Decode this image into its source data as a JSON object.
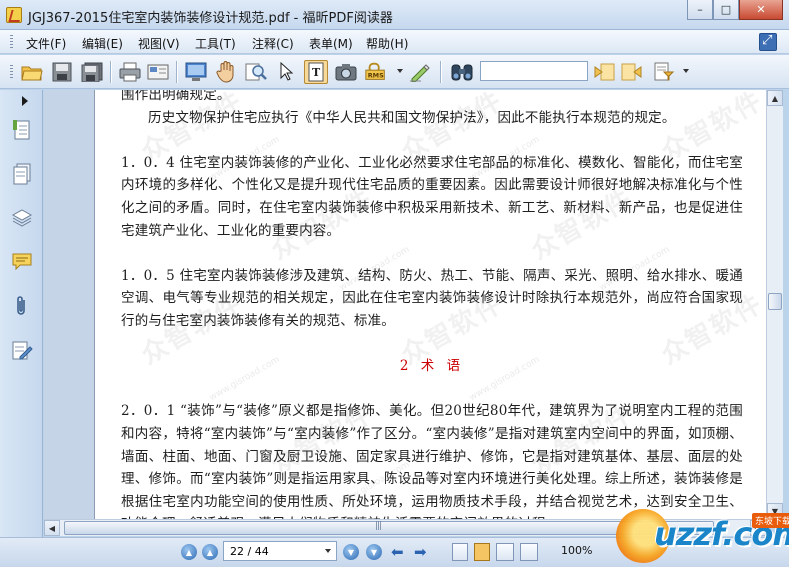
{
  "window": {
    "title": "JGJ367-2015住宅室内装饰装修设计规范.pdf - 福昕PDF阅读器",
    "minimize": "–",
    "maximize": "□",
    "close": "✕"
  },
  "menu": [
    "文件(F)",
    "编辑(E)",
    "视图(V)",
    "工具(T)",
    "注释(C)",
    "表单(M)",
    "帮助(H)"
  ],
  "toolbar": {
    "icons": [
      "open-folder-icon",
      "save-icon",
      "save-all-icon",
      "print-icon",
      "email-icon",
      "fullscreen-icon",
      "hand-tool-icon",
      "zoom-tool-icon",
      "select-arrow-icon",
      "text-select-icon",
      "snapshot-icon",
      "rms-icon",
      "sign-pen-icon",
      "binoculars-icon"
    ],
    "search_value": "",
    "nav_icons": [
      "find-prev-icon",
      "find-next-icon",
      "find-options-icon"
    ]
  },
  "left_panel": {
    "icons": [
      "bookmarks-icon",
      "pages-icon",
      "layers-icon",
      "comments-icon",
      "attachments-icon",
      "signature-icon"
    ]
  },
  "document": {
    "lines": [
      {
        "style": "plain",
        "text": "围作出明确规定。"
      },
      {
        "style": "ind",
        "text": "历史文物保护住宅应执行《中华人民共和国文物保护法》，因此不能执行本规范的规定。"
      },
      {
        "style": "gap",
        "text": ""
      },
      {
        "style": "plain",
        "text": "1．0．4 住宅室内装饰装修的产业化、工业化必然要求住宅部品的标准化、模数化、智能化，而住宅室内环境的多样化、个性化又是提升现代住宅品质的重要因素。因此需要设计师很好地解决标准化与个性化之间的矛盾。同时，在住宅室内装饰装修中积极采用新技术、新工艺、新材料、新产品，也是促进住宅建筑产业化、工业化的重要内容。"
      },
      {
        "style": "gap",
        "text": ""
      },
      {
        "style": "plain",
        "text": "1．0．5 住宅室内装饰装修涉及建筑、结构、防火、热工、节能、隔声、采光、照明、给水排水、暖通空调、电气等专业规范的相关规定，因此在住宅室内装饰装修设计时除执行本规范外，尚应符合国家现行的与住宅室内装饰装修有关的规范、标准。"
      },
      {
        "style": "gap",
        "text": ""
      },
      {
        "style": "heading",
        "text": "2 术 语"
      },
      {
        "style": "gap",
        "text": ""
      },
      {
        "style": "plain",
        "text": "2．0．1 “装饰”与“装修”原义都是指修饰、美化。但20世纪80年代，建筑界为了说明室内工程的范围和内容，特将“室内装饰”与“室内装修”作了区分。“室内装修”是指对建筑室内空间中的界面，如顶棚、墙面、柱面、地面、门窗及厨卫设施、固定家具进行维护、修饰，它是指对建筑基体、基层、面层的处理、修饰。而“室内装饰”则是指运用家具、陈设品等对室内环境进行美化处理。综上所述，装饰装修是根据住宅室内功能空间的使用性质、所处环境，运用物质技术手段，并结合视觉艺术，达到安全卫生、功能合理、舒适美观、满足人们物质和精神生活需要的空间效果的过程。"
      }
    ],
    "watermark_text": "众智软件",
    "watermark_url": "www.gisroad.com"
  },
  "status": {
    "page_value": "22 / 44",
    "zoom": "100%"
  },
  "logo": {
    "text": "uzzf.com",
    "badge": "东坡下载"
  }
}
